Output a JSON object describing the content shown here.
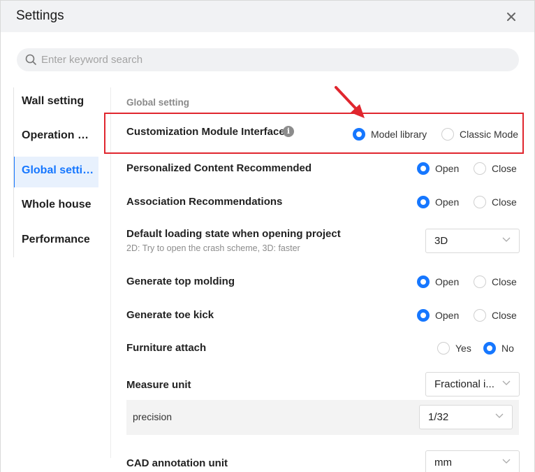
{
  "dialog": {
    "title": "Settings"
  },
  "search": {
    "placeholder": "Enter keyword search",
    "value": ""
  },
  "sidebar": {
    "items": [
      {
        "label": "Wall setting",
        "active": false
      },
      {
        "label": "Operation preference",
        "active": false
      },
      {
        "label": "Global setting",
        "active": true
      },
      {
        "label": "Whole house",
        "active": false
      },
      {
        "label": "Performance",
        "active": false
      }
    ]
  },
  "section": {
    "title": "Global setting"
  },
  "settings": {
    "customization": {
      "label": "Customization Module Interface",
      "options": [
        "Model library",
        "Classic Mode"
      ],
      "selected": "Model library"
    },
    "personalized": {
      "label": "Personalized Content Recommended",
      "options": [
        "Open",
        "Close"
      ],
      "selected": "Open"
    },
    "association": {
      "label": "Association Recommendations",
      "options": [
        "Open",
        "Close"
      ],
      "selected": "Open"
    },
    "loading": {
      "label": "Default loading state when opening project",
      "description": "2D: Try to open the crash scheme, 3D: faster",
      "value": "3D"
    },
    "top_molding": {
      "label": "Generate top molding",
      "options": [
        "Open",
        "Close"
      ],
      "selected": "Open"
    },
    "toe_kick": {
      "label": "Generate toe kick",
      "options": [
        "Open",
        "Close"
      ],
      "selected": "Open"
    },
    "furniture_attach": {
      "label": "Furniture attach",
      "options": [
        "Yes",
        "No"
      ],
      "selected": "No"
    },
    "measure_unit": {
      "label": "Measure unit",
      "value": "Fractional i..."
    },
    "precision": {
      "label": "precision",
      "value": "1/32"
    },
    "cad_unit": {
      "label": "CAD annotation unit",
      "value": "mm"
    }
  },
  "colors": {
    "accent": "#1677ff",
    "highlight": "#e0262e",
    "header_bg": "#f1f2f4"
  }
}
